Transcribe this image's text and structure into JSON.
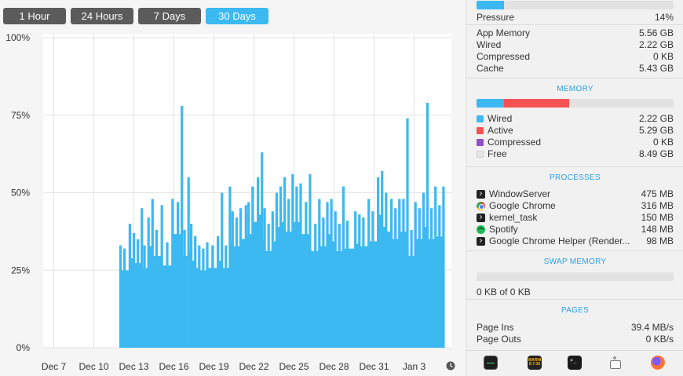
{
  "range_tabs": [
    "1 Hour",
    "24 Hours",
    "7 Days",
    "30 Days"
  ],
  "active_range": "30 Days",
  "colors": {
    "accent": "#3cb9f1",
    "tab_inactive": "#5b5b5b",
    "wired": "#3cb9f1",
    "active": "#f55353",
    "compressed": "#8e4fc9",
    "free": "#e6e6e6",
    "section_title": "#2e9fe0"
  },
  "chart_data": {
    "type": "bar",
    "title": "",
    "xlabel": "",
    "ylabel": "",
    "ylim": [
      0,
      100
    ],
    "grid": true,
    "yticks": [
      "100%",
      "75%",
      "50%",
      "25%",
      "0%"
    ],
    "xticks": [
      "Dec 7",
      "Dec 10",
      "Dec 13",
      "Dec 16",
      "Dec 19",
      "Dec 22",
      "Dec 25",
      "Dec 28",
      "Dec 31",
      "Jan 3"
    ],
    "x_start_day": 0,
    "x_end_day": 30,
    "series": [
      {
        "values": [
          [
            5.5,
            33
          ],
          [
            5.8,
            32
          ],
          [
            6.2,
            40
          ],
          [
            6.5,
            37
          ],
          [
            6.8,
            35
          ],
          [
            7.1,
            45
          ],
          [
            7.3,
            33
          ],
          [
            7.6,
            42
          ],
          [
            7.9,
            48
          ],
          [
            8.2,
            38
          ],
          [
            8.6,
            46
          ],
          [
            9.0,
            34
          ],
          [
            9.4,
            48
          ],
          [
            9.8,
            47
          ],
          [
            10.1,
            78
          ],
          [
            10.3,
            38
          ],
          [
            10.6,
            55
          ],
          [
            10.8,
            40
          ],
          [
            11.1,
            36
          ],
          [
            11.4,
            33
          ],
          [
            11.7,
            32
          ],
          [
            12.0,
            34
          ],
          [
            12.4,
            33
          ],
          [
            12.8,
            36
          ],
          [
            13.1,
            50
          ],
          [
            13.4,
            33
          ],
          [
            13.7,
            52
          ],
          [
            13.9,
            44
          ],
          [
            14.2,
            42
          ],
          [
            14.5,
            45
          ],
          [
            14.9,
            46
          ],
          [
            15.1,
            47
          ],
          [
            15.4,
            52
          ],
          [
            15.8,
            55
          ],
          [
            16.1,
            63
          ],
          [
            16.3,
            45
          ],
          [
            16.6,
            40
          ],
          [
            16.9,
            44
          ],
          [
            17.2,
            50
          ],
          [
            17.5,
            52
          ],
          [
            17.8,
            55
          ],
          [
            18.1,
            48
          ],
          [
            18.4,
            56
          ],
          [
            18.7,
            52
          ],
          [
            19.0,
            53
          ],
          [
            19.4,
            47
          ],
          [
            19.7,
            56
          ],
          [
            20.1,
            40
          ],
          [
            20.4,
            48
          ],
          [
            20.7,
            42
          ],
          [
            21.0,
            47
          ],
          [
            21.3,
            48
          ],
          [
            21.6,
            44
          ],
          [
            21.9,
            40
          ],
          [
            22.2,
            52
          ],
          [
            22.5,
            41
          ],
          [
            23.1,
            44
          ],
          [
            23.4,
            43
          ],
          [
            23.7,
            42
          ],
          [
            24.1,
            48
          ],
          [
            24.4,
            44
          ],
          [
            24.8,
            55
          ],
          [
            25.1,
            57
          ],
          [
            25.4,
            50
          ],
          [
            25.8,
            48
          ],
          [
            26.1,
            45
          ],
          [
            26.4,
            48
          ],
          [
            26.7,
            48
          ],
          [
            27.0,
            74
          ],
          [
            27.3,
            38
          ],
          [
            27.6,
            47
          ],
          [
            27.9,
            45
          ],
          [
            28.2,
            50
          ],
          [
            28.5,
            79
          ],
          [
            28.8,
            45
          ],
          [
            29.1,
            52
          ],
          [
            29.4,
            46
          ],
          [
            29.7,
            52
          ]
        ]
      }
    ]
  },
  "pressure": {
    "label": "Pressure",
    "value": "14%",
    "fraction": 0.14
  },
  "memory_summary": [
    {
      "label": "App Memory",
      "value": "5.56 GB"
    },
    {
      "label": "Wired",
      "value": "2.22 GB"
    },
    {
      "label": "Compressed",
      "value": "0 KB"
    },
    {
      "label": "Cache",
      "value": "5.43 GB"
    }
  ],
  "memory": {
    "title": "MEMORY",
    "bar_fractions": {
      "wired": 0.1392,
      "active": 0.3318,
      "compressed": 0.0
    },
    "rows": [
      {
        "label": "Wired",
        "value": "2.22 GB",
        "color": "#3cb9f1"
      },
      {
        "label": "Active",
        "value": "5.29 GB",
        "color": "#f55353"
      },
      {
        "label": "Compressed",
        "value": "0 KB",
        "color": "#8e4fc9"
      },
      {
        "label": "Free",
        "value": "8.49 GB",
        "color": "#e6e6e6"
      }
    ]
  },
  "processes": {
    "title": "PROCESSES",
    "rows": [
      {
        "icon": "terminal-icon",
        "label": "WindowServer",
        "value": "475 MB"
      },
      {
        "icon": "chrome-icon",
        "label": "Google Chrome",
        "value": "316 MB"
      },
      {
        "icon": "terminal-icon",
        "label": "kernel_task",
        "value": "150 MB"
      },
      {
        "icon": "spotify-icon",
        "label": "Spotify",
        "value": "148 MB"
      },
      {
        "icon": "terminal-icon",
        "label": "Google Chrome Helper (Render...",
        "value": "98 MB"
      }
    ]
  },
  "swap": {
    "title": "SWAP MEMORY",
    "text": "0 KB of 0 KB",
    "fraction": 0
  },
  "pages": {
    "title": "PAGES",
    "rows": [
      {
        "label": "Page Ins",
        "value": "39.4 MB/s"
      },
      {
        "label": "Page Outs",
        "value": "0 KB/s"
      }
    ]
  },
  "dock": {
    "console_text": "WARNI\n9:7:36"
  }
}
